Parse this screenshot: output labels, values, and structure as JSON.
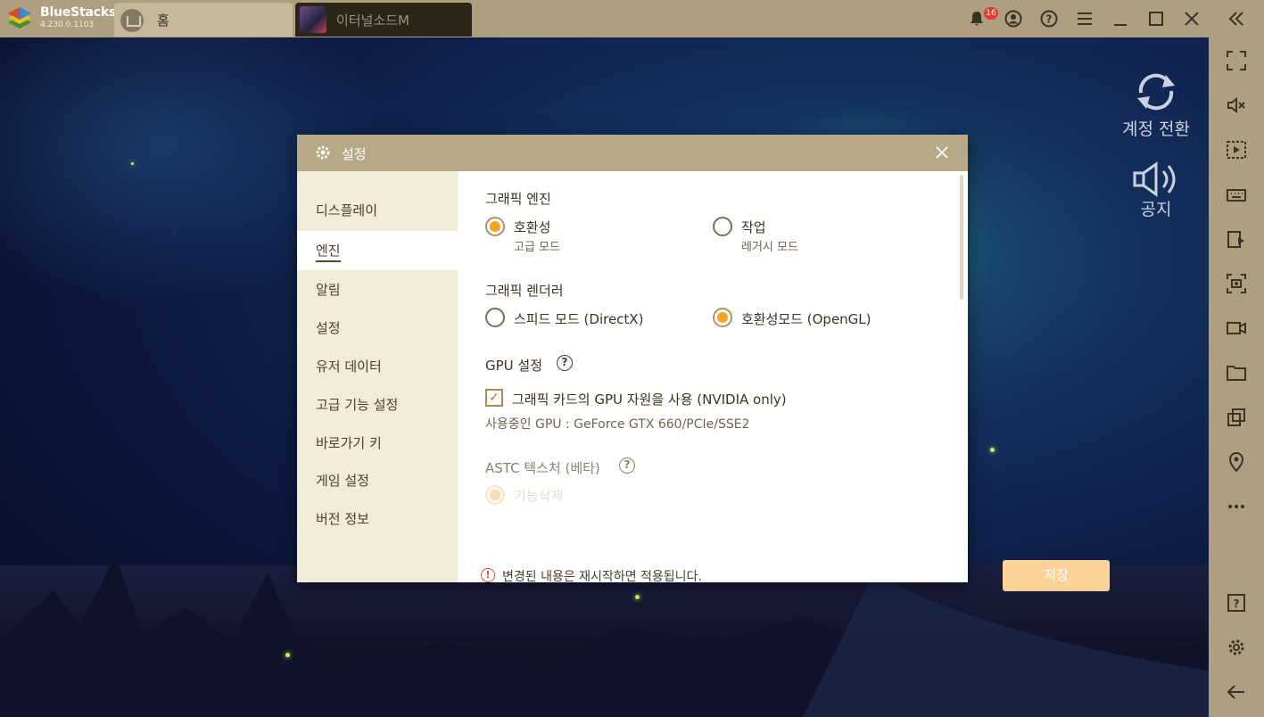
{
  "app": {
    "name": "BlueStacks",
    "version": "4.230.0.1103"
  },
  "tabs": [
    {
      "label": "홈"
    },
    {
      "label": "이터널소드M"
    }
  ],
  "titlebar": {
    "notification_count": "16"
  },
  "overlay": {
    "account_switch": "계정 전환",
    "notice": "공지"
  },
  "dialog": {
    "title": "설정",
    "nav": [
      {
        "label": "디스플레이"
      },
      {
        "label": "엔진"
      },
      {
        "label": "알림"
      },
      {
        "label": "설정"
      },
      {
        "label": "유저 데이터"
      },
      {
        "label": "고급 기능 설정"
      },
      {
        "label": "바로가기 키"
      },
      {
        "label": "게임 설정"
      },
      {
        "label": "버전 정보"
      }
    ],
    "graphics_engine": {
      "title": "그래픽 엔진",
      "options": [
        {
          "label": "호환성",
          "sub": "고급 모드",
          "selected": true
        },
        {
          "label": "작업",
          "sub": "레거시 모드",
          "selected": false
        }
      ]
    },
    "graphics_renderer": {
      "title": "그래픽 렌더러",
      "options": [
        {
          "label": "스피드 모드 (DirectX)",
          "selected": false
        },
        {
          "label": "호환성모드 (OpenGL)",
          "selected": true
        }
      ]
    },
    "gpu": {
      "title": "GPU 설정",
      "checkbox_label": "그래픽 카드의 GPU 자원을 사용 (NVIDIA only)",
      "checked": true,
      "info": "사용중인 GPU : GeForce GTX 660/PCIe/SSE2"
    },
    "astc": {
      "title": "ASTC 텍스처 (베타)",
      "option_label": "기능삭제"
    },
    "notice": "변경된 내용은 재시작하면 적용됩니다.",
    "save_label": "저장"
  },
  "colors": {
    "chrome": "#ad9f7f",
    "accent_radio": "#f6a321",
    "save_disabled": "#fbd399",
    "nav_bg": "#f2ebda"
  }
}
